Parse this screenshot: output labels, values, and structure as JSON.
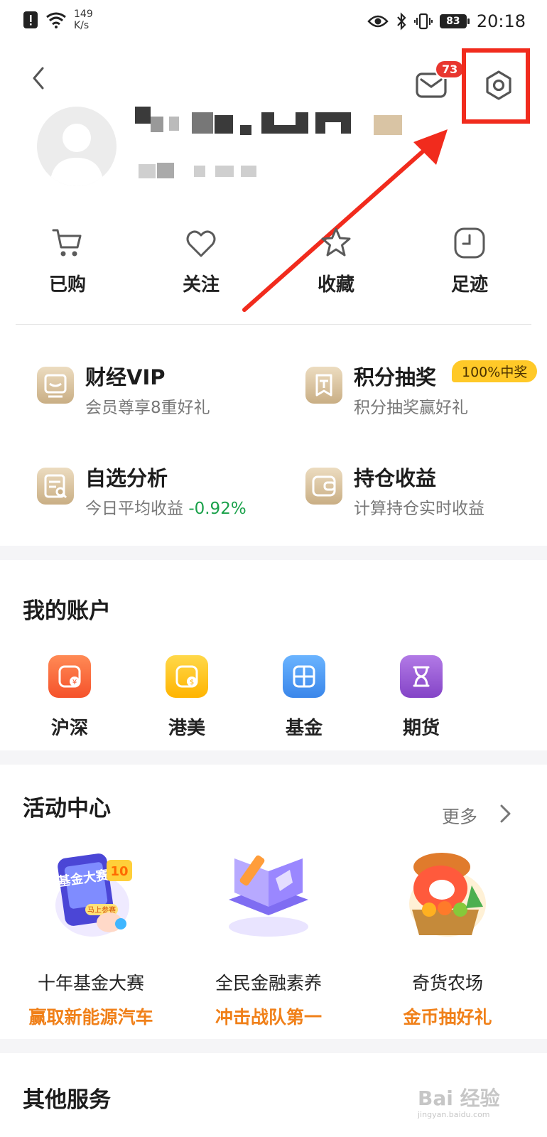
{
  "status_bar": {
    "net_speed_value": "149",
    "net_speed_unit": "K/s",
    "battery": "83",
    "time": "20:18"
  },
  "header": {
    "mail_badge": "73"
  },
  "quick_actions": [
    {
      "label": "已购",
      "icon": "cart-icon"
    },
    {
      "label": "关注",
      "icon": "heart-icon"
    },
    {
      "label": "收藏",
      "icon": "star-icon"
    },
    {
      "label": "足迹",
      "icon": "clock-icon"
    }
  ],
  "services": [
    {
      "title": "财经VIP",
      "desc": "会员尊享8重好礼",
      "icon": "vip-icon"
    },
    {
      "title": "积分抽奖",
      "desc": "积分抽奖赢好礼",
      "tag": "100%中奖",
      "icon": "lottery-icon"
    },
    {
      "title": "自选分析",
      "desc": "今日平均收益",
      "value": "-0.92%",
      "icon": "analysis-icon"
    },
    {
      "title": "持仓收益",
      "desc": "计算持仓实时收益",
      "icon": "wallet-icon"
    }
  ],
  "accounts": {
    "title": "我的账户",
    "items": [
      {
        "label": "沪深",
        "color": "#fa6a3a"
      },
      {
        "label": "港美",
        "color": "#ffc21a"
      },
      {
        "label": "基金",
        "color": "#4a9df5"
      },
      {
        "label": "期货",
        "color": "#9b5fd6"
      }
    ]
  },
  "activities": {
    "title": "活动中心",
    "more": "更多",
    "items": [
      {
        "name": "十年基金大赛",
        "slogan": "赢取新能源汽车",
        "poster_text": "基金大赛",
        "poster_badge": "10",
        "poster_tag": "马上参赛"
      },
      {
        "name": "全民金融素养",
        "slogan": "冲击战队第一"
      },
      {
        "name": "奇货农场",
        "slogan": "金币抽好礼"
      }
    ]
  },
  "other": {
    "title": "其他服务"
  },
  "watermark": {
    "brand": "Bai 经验",
    "url": "jingyan.baidu.com"
  }
}
